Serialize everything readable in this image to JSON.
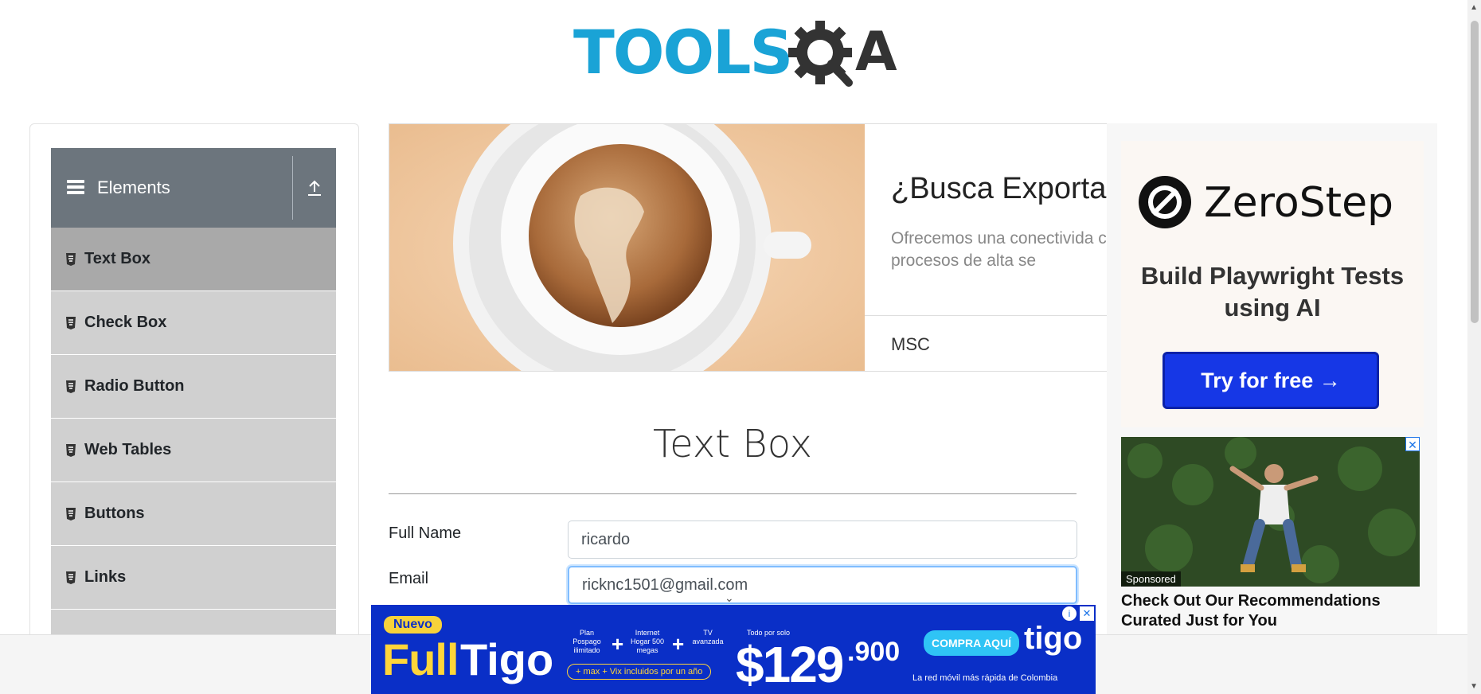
{
  "header": {
    "logo_text": "TOOLS",
    "logo_suffix": "A"
  },
  "sidebar": {
    "group_title": "Elements",
    "items": [
      {
        "label": "Text Box",
        "active": true
      },
      {
        "label": "Check Box"
      },
      {
        "label": "Radio Button"
      },
      {
        "label": "Web Tables"
      },
      {
        "label": "Buttons"
      },
      {
        "label": "Links"
      }
    ]
  },
  "banner": {
    "title": "¿Busca Exportar",
    "description": "Ofrecemos una conectivida clase y procesos de alta se",
    "brand": "MSC"
  },
  "main": {
    "title": "Text Box",
    "fields": [
      {
        "label": "Full Name",
        "value": "ricardo"
      },
      {
        "label": "Email",
        "value": "ricknc1501@gmail.com"
      }
    ]
  },
  "right_ad": {
    "brand": "ZeroStep",
    "tagline": "Build Playwright Tests using AI",
    "cta": "Try for free →",
    "sponsored_badge": "Sponsored",
    "sponsored_caption": "Check Out Our Recommendations Curated Just for You"
  },
  "bottom_ad": {
    "badge": "Nuevo",
    "full": "Full",
    "tigo": "Tigo",
    "plan_1": "Plan Pospago ilimitado",
    "plan_2": "Internet Hogar 500 megas",
    "plan_3": "TV avanzada",
    "price_prefix": "Todo por solo",
    "price": "$129",
    "price_cents": ".900",
    "cta": "COMPRA AQUÍ",
    "logo": "tigo",
    "pill": "+ max + Vix incluidos por un año",
    "tagline": "La red móvil más rápida de Colombia",
    "close": "✕",
    "info": "i"
  },
  "colors": {
    "sidebar_header": "#6c757d",
    "menu_item": "#d0d0d0",
    "menu_item_active": "#a9a9a9",
    "logo_blue": "#1aa3d6",
    "cta_blue": "#1637e6",
    "tigo_blue": "#0a2fc7"
  }
}
